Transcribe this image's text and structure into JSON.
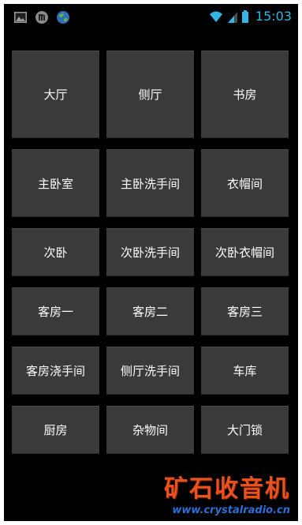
{
  "status_bar": {
    "time": "15:03",
    "icons_left": [
      "image-icon",
      "mi-icon",
      "globe-icon"
    ],
    "icons_right": [
      "wifi-icon",
      "signal-icon",
      "battery-icon"
    ],
    "accent_color": "#33b5e5"
  },
  "rooms": [
    [
      "大厅",
      "侧厅",
      "书房"
    ],
    [
      "主卧室",
      "主卧洗手间",
      "衣帽间"
    ],
    [
      "次卧",
      "次卧洗手间",
      "次卧衣帽间"
    ],
    [
      "客房一",
      "客房二",
      "客房三"
    ],
    [
      "客房浇手间",
      "侧厅洗手间",
      "车库"
    ],
    [
      "厨房",
      "杂物间",
      "大门锁"
    ]
  ],
  "watermark": {
    "title": "矿石收音机",
    "url": "www.crystalradio.cn"
  },
  "colors": {
    "background": "#000000",
    "tile": "#3a3a3a",
    "tile_text": "#ffffff"
  }
}
